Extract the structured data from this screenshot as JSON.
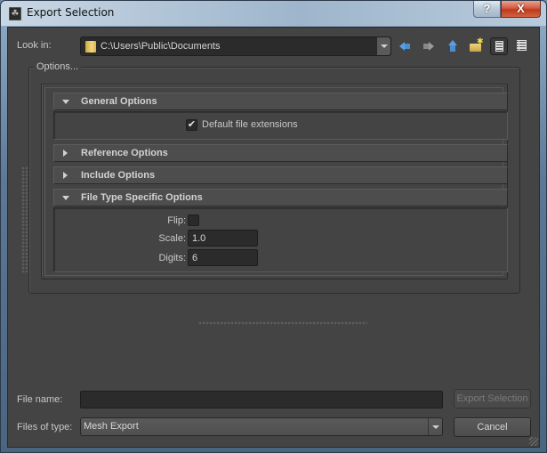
{
  "window": {
    "title": "Export Selection",
    "help_label": "?",
    "close_label": "X"
  },
  "toolbar": {
    "look_in_label": "Look in:",
    "look_in_path": "C:\\Users\\Public\\Documents",
    "icons": [
      "back-arrow-icon",
      "forward-arrow-icon",
      "parent-folder-up-icon",
      "new-folder-icon",
      "detail-view-icon",
      "list-view-icon"
    ]
  },
  "options": {
    "title": "Options...",
    "sections": [
      {
        "label": "General Options",
        "expanded": true
      },
      {
        "label": "Reference Options",
        "expanded": false
      },
      {
        "label": "Include Options",
        "expanded": false
      },
      {
        "label": "File Type Specific Options",
        "expanded": true
      }
    ],
    "general": {
      "default_ext_label": "Default file extensions",
      "default_ext_checked": true,
      "check_glyph": "✔"
    },
    "file_type": {
      "flip_label": "Flip:",
      "flip_checked": false,
      "scale_label": "Scale:",
      "scale_value": "1.0",
      "digits_label": "Digits:",
      "digits_value": "6"
    }
  },
  "footer": {
    "file_name_label": "File name:",
    "file_name_value": "",
    "files_of_type_label": "Files of type:",
    "files_of_type_value": "Mesh Export",
    "export_button": "Export Selection",
    "export_enabled": false,
    "cancel_button": "Cancel"
  },
  "colors": {
    "panel_bg": "#444444",
    "field_bg": "#2b2b2b",
    "close_red": "#c7432a"
  }
}
